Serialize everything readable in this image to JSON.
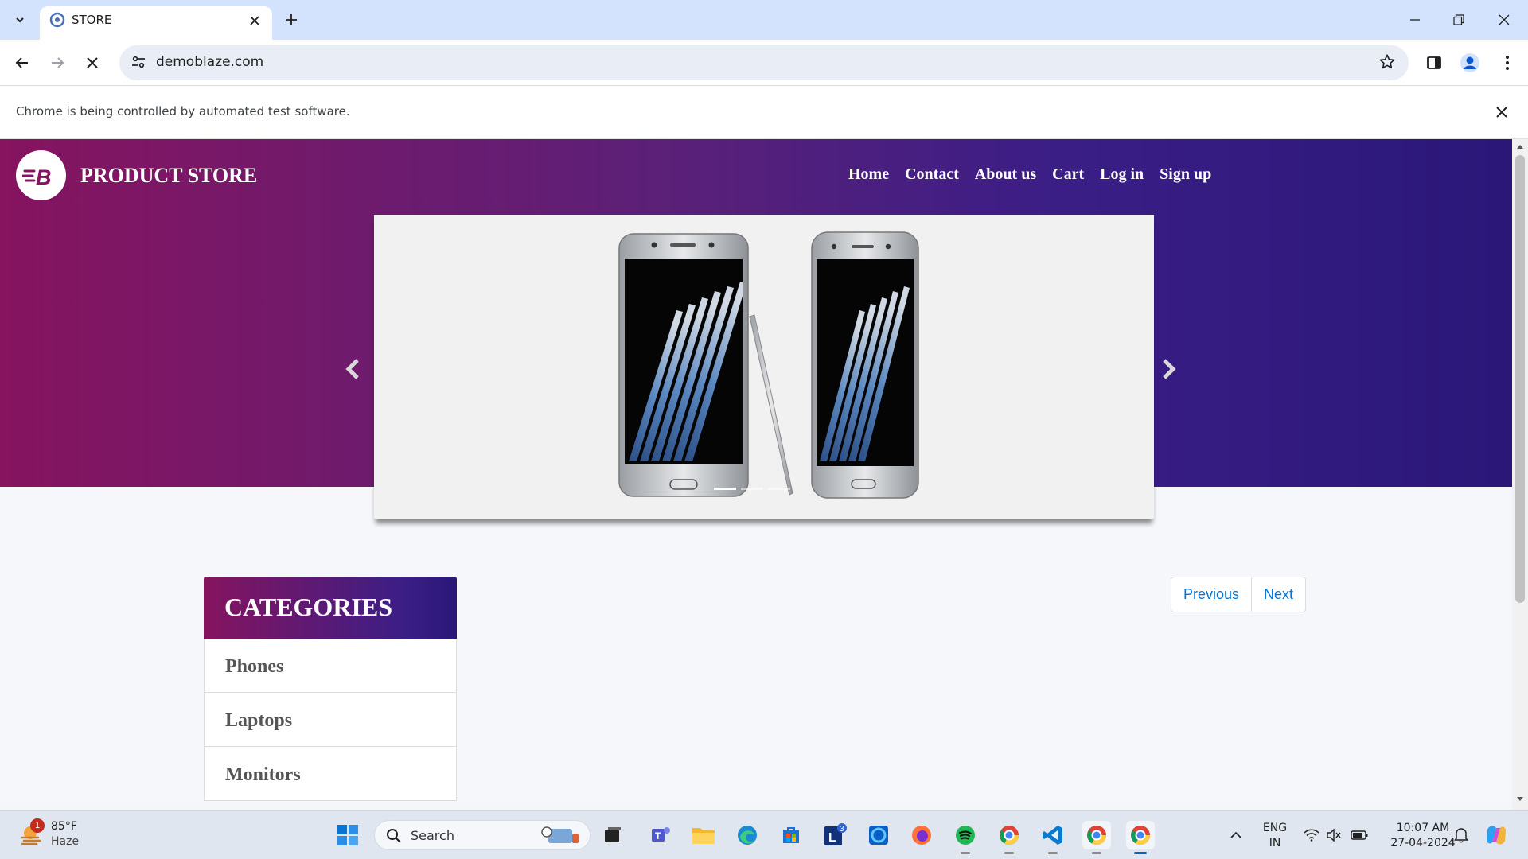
{
  "browser": {
    "tab_title": "STORE",
    "url": "demoblaze.com",
    "infobar_message": "Chrome is being controlled by automated test software."
  },
  "site": {
    "brand": "PRODUCT STORE",
    "nav": [
      "Home",
      "Contact",
      "About us",
      "Cart",
      "Log in",
      "Sign up"
    ],
    "categories_title": "CATEGORIES",
    "categories": [
      "Phones",
      "Laptops",
      "Monitors"
    ],
    "pager": {
      "previous": "Previous",
      "next": "Next"
    }
  },
  "taskbar": {
    "weather_temp": "85°F",
    "weather_condition": "Haze",
    "weather_badge": "1",
    "search_placeholder": "Search",
    "lang_primary": "ENG",
    "lang_secondary": "IN",
    "time": "10:07 AM",
    "date": "27-04-2024",
    "teams_badge": "3"
  },
  "colors": {
    "brand_gradient_start": "#86145f",
    "brand_gradient_end": "#2a1778",
    "link_blue": "#0275d8",
    "chrome_frame": "#d3e3fd"
  },
  "icons": [
    "tab-search-icon",
    "store-favicon",
    "close-icon",
    "new-tab-icon",
    "minimize-icon",
    "restore-icon",
    "back-icon",
    "forward-icon",
    "stop-loading-icon",
    "site-info-icon",
    "bookmark-star-icon",
    "side-panel-icon",
    "profile-icon",
    "menu-kebab-icon",
    "chevron-left-icon",
    "chevron-right-icon",
    "windows-start-icon",
    "search-icon"
  ]
}
